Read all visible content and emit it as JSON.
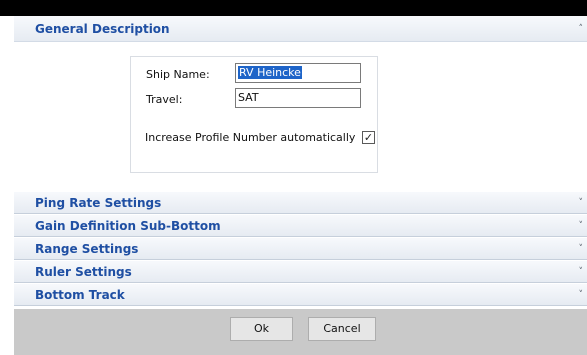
{
  "general": {
    "title": "General Description",
    "chevron": "˄",
    "ship_name_label": "Ship Name:",
    "ship_name_value": "RV Heincke",
    "travel_label": "Travel:",
    "travel_value": "SAT",
    "increase_label": "Increase Profile Number automatically",
    "increase_checked": true,
    "check_glyph": "✓"
  },
  "sections": [
    {
      "title": "Ping Rate Settings",
      "chevron": "˅"
    },
    {
      "title": "Gain Definition Sub-Bottom",
      "chevron": "˅"
    },
    {
      "title": "Range Settings",
      "chevron": "˅"
    },
    {
      "title": "Ruler Settings",
      "chevron": "˅"
    },
    {
      "title": "Bottom Track",
      "chevron": "˅"
    }
  ],
  "buttons": {
    "ok": "Ok",
    "cancel": "Cancel"
  }
}
